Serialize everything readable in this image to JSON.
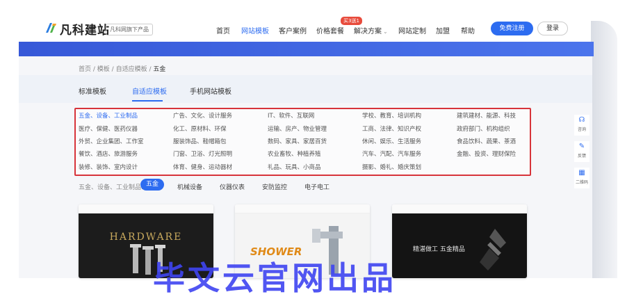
{
  "brand": {
    "name": "凡科建站",
    "tag": "凡科网旗下产品"
  },
  "nav": [
    {
      "label": "首页",
      "active": false
    },
    {
      "label": "网站模板",
      "active": true
    },
    {
      "label": "客户案例",
      "active": false
    },
    {
      "label": "价格套餐",
      "active": false
    },
    {
      "label": "解决方案",
      "active": false
    },
    {
      "label": "网站定制",
      "active": false
    },
    {
      "label": "加盟",
      "active": false
    },
    {
      "label": "帮助",
      "active": false
    }
  ],
  "hot_badge": "买3送1",
  "register_label": "免费注册",
  "login_label": "登录",
  "breadcrumb": [
    "首页",
    "模板",
    "自适应模板",
    "五金"
  ],
  "tabs": [
    "标准模板",
    "自适应模板",
    "手机网站模板"
  ],
  "categories": [
    [
      "五金、设备、工业制品",
      "广告、文化、设计服务",
      "IT、软件、互联网",
      "学校、教育、培训机构",
      "建筑建材、能源、科技"
    ],
    [
      "医疗、保健、医药仪器",
      "化工、原材料、环保",
      "运输、房产、物业管理",
      "工商、法律、知识产权",
      "政府部门、机构组织"
    ],
    [
      "外贸、企业集团、工作室",
      "服装饰品、鞋帽箱包",
      "数码、家具、家居百货",
      "休闲、娱乐、生活服务",
      "食品饮料、蔬果、茶酒"
    ],
    [
      "餐饮、酒店、旅游服务",
      "门窗、卫浴、灯光照明",
      "农业畜牧、种植养殖",
      "汽车、汽配、汽车服务",
      "金融、投资、理财保险"
    ],
    [
      "装修、装饰、室内设计",
      "体育、健身、运动器材",
      "礼品、玩具、小商品",
      "摄影、婚礼、婚庆策划",
      ""
    ]
  ],
  "filter": {
    "label": "五金、设备、工业制品:",
    "active": "五金",
    "options": [
      "机械设备",
      "仪器仪表",
      "安防监控",
      "电子电工"
    ]
  },
  "templates": [
    {
      "headline": "HARDWARE"
    },
    {
      "headline": "SHOWER"
    },
    {
      "headline": "精湛做工 五金精品"
    }
  ],
  "tools": [
    "咨询",
    "反馈",
    "二维码"
  ],
  "watermark": "毕文云官网出品",
  "colors": {
    "accent": "#2d6cf0",
    "banner": "#3a62e0",
    "highlight_box": "#d7333a"
  }
}
